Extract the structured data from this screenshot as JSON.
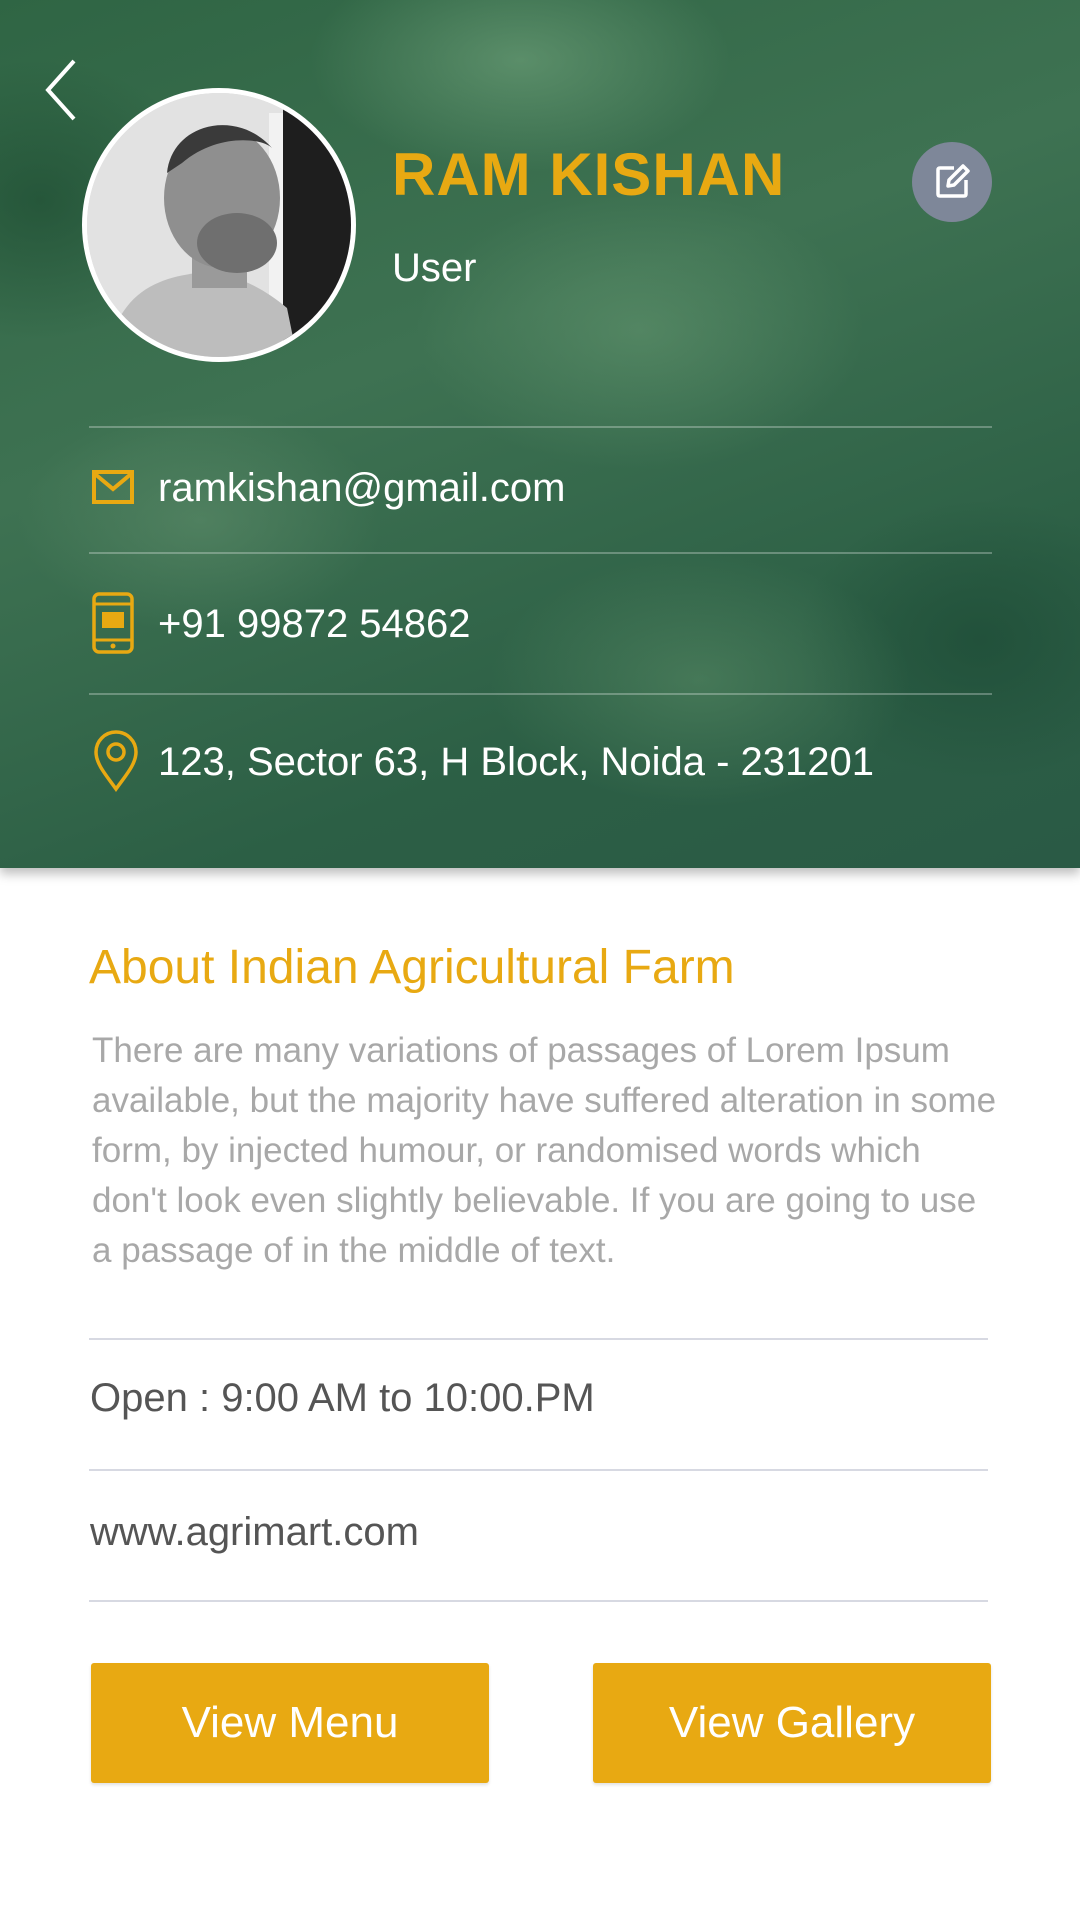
{
  "profile": {
    "name": "RAM KISHAN",
    "role": "User",
    "email": "ramkishan@gmail.com",
    "phone": "+91 99872 54862",
    "address": "123, Sector 63, H Block, Noida - 231201"
  },
  "about": {
    "title": "About Indian Agricultural Farm",
    "text": "There are many variations of passages of Lorem Ipsum available, but the majority have suffered alteration in some form, by injected humour, or randomised words which don't look even slightly believable. If you are going to use a passage of in the middle of text."
  },
  "details": {
    "hours": "Open : 9:00 AM to 10:00.PM",
    "website": "www.agrimart.com"
  },
  "buttons": {
    "view_menu": "View Menu",
    "view_gallery": "View Gallery"
  },
  "icons": {
    "back": "chevron-left-icon",
    "edit": "edit-icon",
    "email": "mail-icon",
    "phone": "phone-icon",
    "address": "location-pin-icon"
  },
  "colors": {
    "accent": "#e8a912",
    "header_green": "#2f6544",
    "edit_button": "#7e8799",
    "muted_text": "#a8a8a8"
  }
}
